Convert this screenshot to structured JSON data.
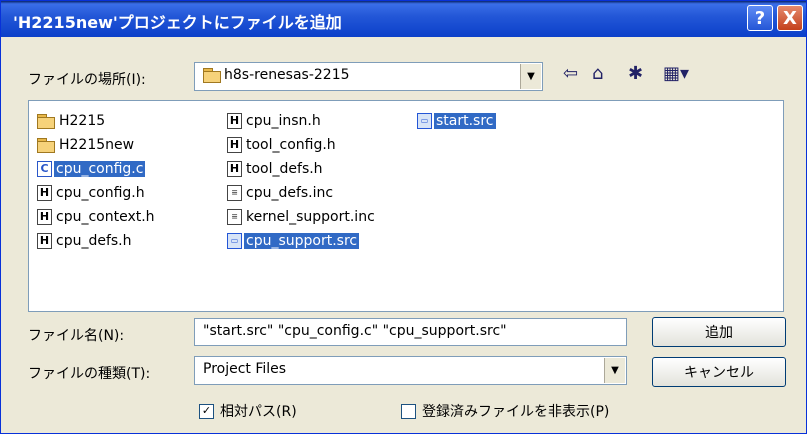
{
  "window": {
    "title": "'H2215new'プロジェクトにファイルを追加",
    "help_label": "?",
    "close_label": "X"
  },
  "look_in": {
    "label": "ファイルの場所(I):",
    "value": "h8s-renesas-2215"
  },
  "toolbar": {
    "back_icon": "back-arrow-icon",
    "up_icon": "up-folder-icon",
    "new_folder_icon": "new-folder-icon",
    "view_icon": "view-menu-icon"
  },
  "files": [
    {
      "name": "H2215",
      "type": "folder",
      "selected": false
    },
    {
      "name": "H2215new",
      "type": "folder",
      "selected": false
    },
    {
      "name": "cpu_config.c",
      "type": "c",
      "selected": true
    },
    {
      "name": "cpu_config.h",
      "type": "h",
      "selected": false
    },
    {
      "name": "cpu_context.h",
      "type": "h",
      "selected": false
    },
    {
      "name": "cpu_defs.h",
      "type": "h",
      "selected": false
    },
    {
      "name": "cpu_insn.h",
      "type": "h",
      "selected": false
    },
    {
      "name": "tool_config.h",
      "type": "h",
      "selected": false
    },
    {
      "name": "tool_defs.h",
      "type": "h",
      "selected": false
    },
    {
      "name": "cpu_defs.inc",
      "type": "inc",
      "selected": false
    },
    {
      "name": "kernel_support.inc",
      "type": "inc",
      "selected": false
    },
    {
      "name": "cpu_support.src",
      "type": "src",
      "selected": true
    },
    {
      "name": "start.src",
      "type": "src",
      "selected": true
    }
  ],
  "filename": {
    "label": "ファイル名(N):",
    "value": "\"start.src\" \"cpu_config.c\" \"cpu_support.src\""
  },
  "filetype": {
    "label": "ファイルの種類(T):",
    "value": "Project Files"
  },
  "buttons": {
    "add": "追加",
    "cancel": "キャンセル"
  },
  "options": {
    "relative_path": {
      "label": "相対パス(R)",
      "checked": true,
      "mark": "✓"
    },
    "hide_registered": {
      "label": "登録済みファイルを非表示(P)",
      "checked": false,
      "mark": ""
    }
  }
}
